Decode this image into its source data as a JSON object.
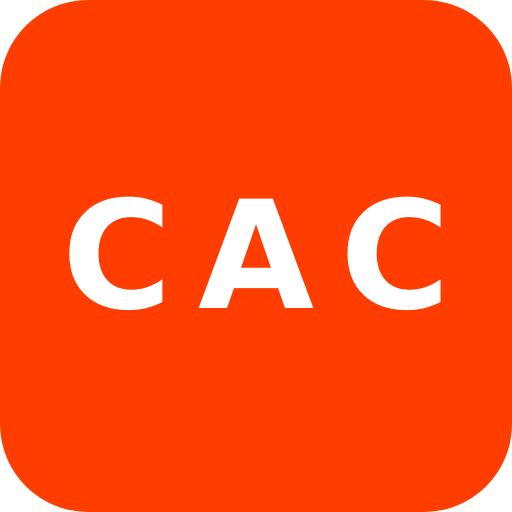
{
  "app_icon": {
    "text": "CAC",
    "background_color": "#FF3D00",
    "text_color": "#FFFFFF"
  }
}
